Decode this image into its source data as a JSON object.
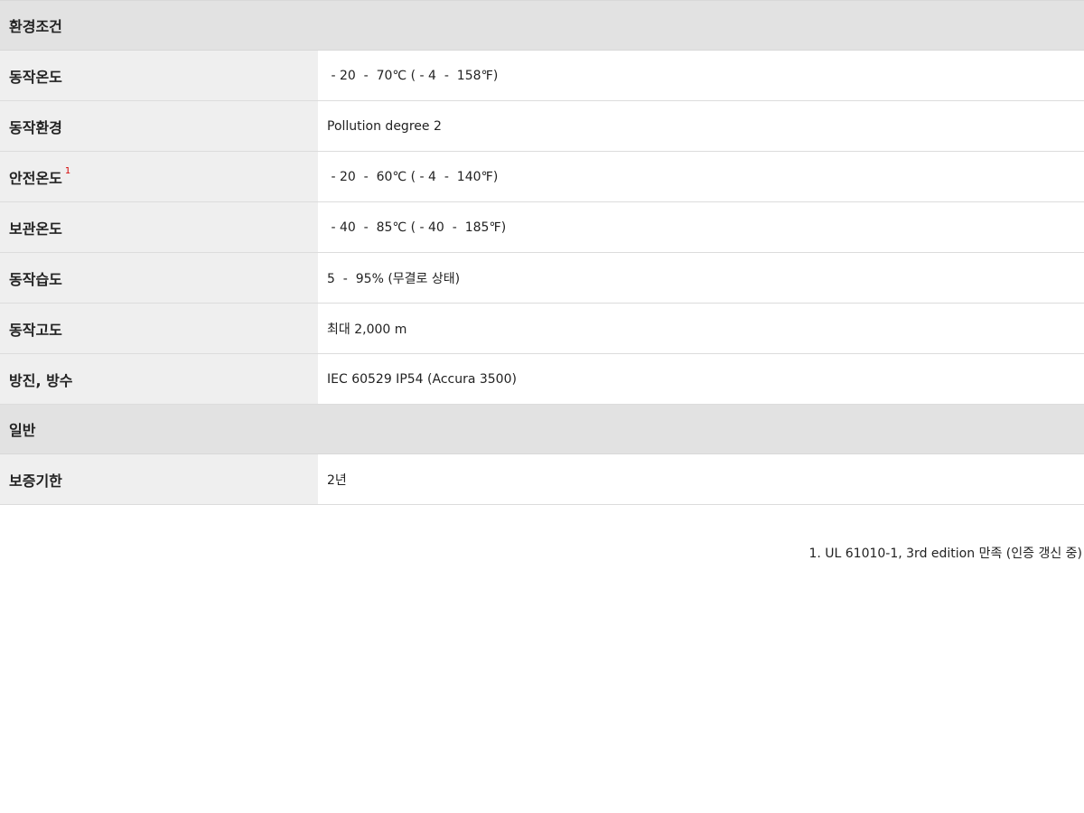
{
  "sections": [
    {
      "title": "환경조건",
      "rows": [
        {
          "label": "동작온도",
          "value": " - 20  -  70℃ ( - 4  -  158℉)"
        },
        {
          "label": "동작환경",
          "value": "Pollution degree 2"
        },
        {
          "label": "안전온도",
          "footnote": "1",
          "value": " - 20  -  60℃ ( - 4  -  140℉)"
        },
        {
          "label": "보관온도",
          "value": " - 40  -  85℃ ( - 40  -  185℉)"
        },
        {
          "label": "동작습도",
          "value": "5  -  95% (무결로 상태)"
        },
        {
          "label": "동작고도",
          "value": "최대 2,000 m"
        },
        {
          "label": "방진, 방수",
          "value": "IEC 60529 IP54 (Accura 3500)"
        }
      ]
    },
    {
      "title": "일반",
      "rows": [
        {
          "label": "보증기한",
          "value": "2년"
        }
      ]
    }
  ],
  "footnote": "1. UL 61010-1, 3rd edition 만족 (인증 갱신 중)"
}
